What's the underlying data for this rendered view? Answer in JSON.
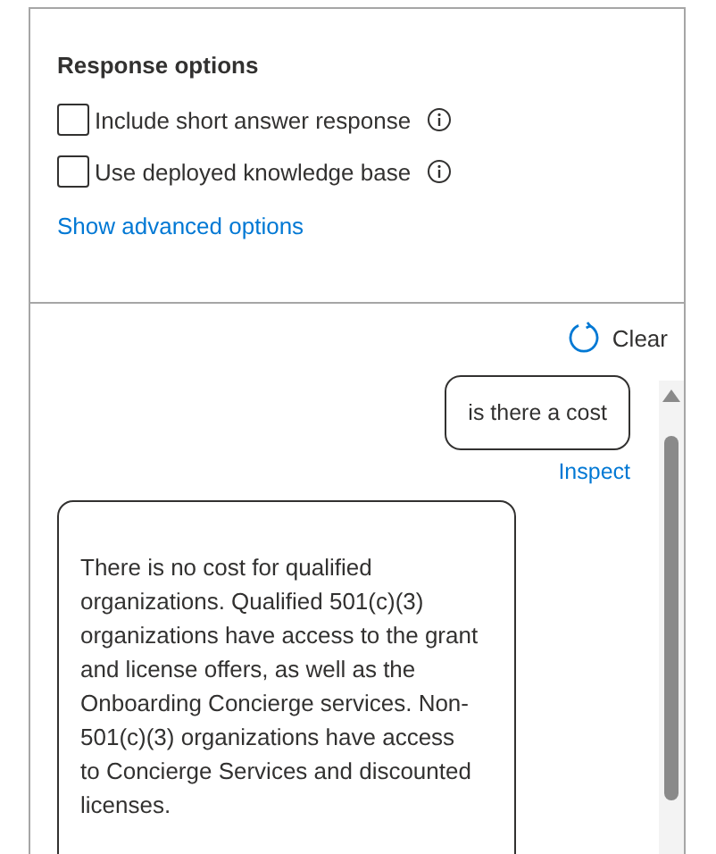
{
  "response_options": {
    "title": "Response options",
    "checkboxes": [
      {
        "label": "Include short answer response",
        "checked": false
      },
      {
        "label": "Use deployed knowledge base",
        "checked": false
      }
    ],
    "link": "Show advanced options"
  },
  "chat": {
    "clear_button": "Clear",
    "messages": [
      {
        "kind": "user",
        "text": "is there a cost",
        "action": "Inspect"
      },
      {
        "kind": "bot",
        "text": "There is no cost for qualified organizations. Qualified 501(c)(3) organizations have access to the grant and license offers, as well as the Onboarding Concierge services. Non-501(c)(3) organizations have access to Concierge Services and discounted licenses."
      }
    ]
  }
}
